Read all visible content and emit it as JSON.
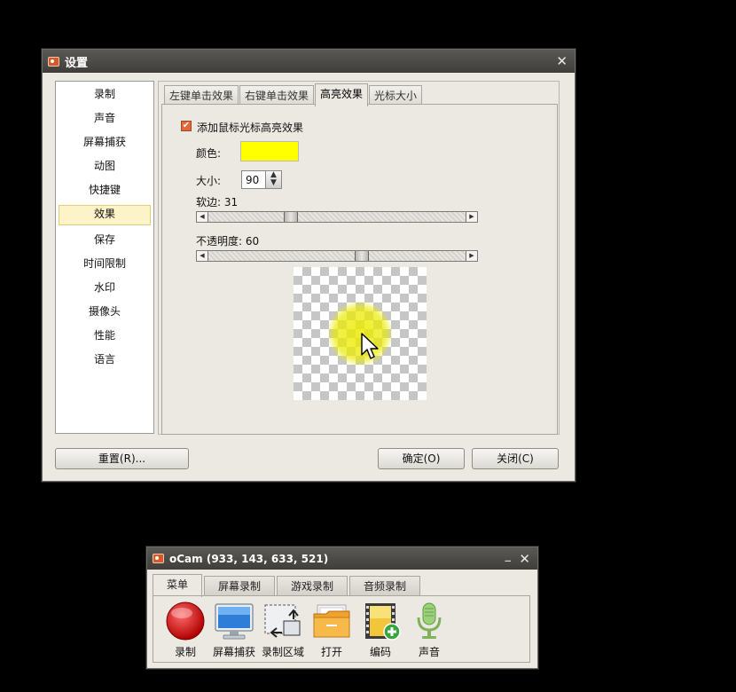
{
  "settings": {
    "title": "设置",
    "close_glyph": "✕",
    "nav": [
      "录制",
      "声音",
      "屏幕捕获",
      "动图",
      "快捷键",
      "效果",
      "保存",
      "时间限制",
      "水印",
      "摄像头",
      "性能",
      "语言"
    ],
    "active_nav_index": 5,
    "tabs": [
      "左键单击效果",
      "右键单击效果",
      "高亮效果",
      "光标大小"
    ],
    "active_tab_index": 2,
    "highlight": {
      "enable_label": "添加鼠标光标高亮效果",
      "enabled": true,
      "color_label": "颜色:",
      "color_value": "#ffff00",
      "size_label": "大小:",
      "size_value": "90",
      "softness_label": "软边: 31",
      "softness_value": 31,
      "opacity_label": "不透明度: 60",
      "opacity_value": 60
    },
    "buttons": {
      "reset": "重置(R)...",
      "ok": "确定(O)",
      "close": "关闭(C)"
    }
  },
  "ocam": {
    "title": "oCam (933, 143, 633, 521)",
    "min_glyph": "_",
    "close_glyph": "✕",
    "tabs": [
      "菜单",
      "屏幕录制",
      "游戏录制",
      "音频录制"
    ],
    "active_tab_index": 0,
    "tools": [
      {
        "label": "录制",
        "icon": "record-icon"
      },
      {
        "label": "屏幕捕获",
        "icon": "monitor-icon"
      },
      {
        "label": "录制区域",
        "icon": "resize-region-icon"
      },
      {
        "label": "打开",
        "icon": "folder-icon"
      },
      {
        "label": "编码",
        "icon": "film-add-icon"
      },
      {
        "label": "声音",
        "icon": "microphone-icon"
      }
    ]
  },
  "colors": {
    "titlebar": "#4a4945",
    "window_bg": "#ece9e3",
    "highlight_yellow": "#ffff00",
    "checkbox": "#e0693c",
    "nav_active_bg": "#fdf3c9"
  }
}
